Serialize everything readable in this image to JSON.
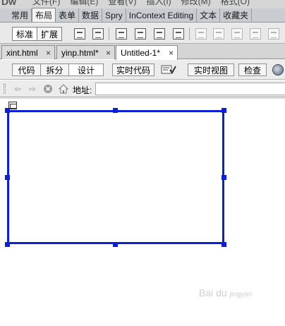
{
  "menubar": {
    "logo": "Dw",
    "items": [
      "文件(F)",
      "编辑(E)",
      "查看(V)",
      "插入(I)",
      "修改(M)",
      "格式(O)"
    ]
  },
  "insert_tabs": [
    "常用",
    "布局",
    "表单",
    "数据",
    "Spry",
    "InContext Editing",
    "文本",
    "收藏夹"
  ],
  "insert_tabs_active": "布局",
  "layout_toolbar": {
    "modes": [
      "标准",
      "扩展"
    ],
    "active_mode": "标准"
  },
  "document_tabs": [
    {
      "name": "xint.html",
      "close": "×"
    },
    {
      "name": "yinp.html*",
      "close": "×"
    },
    {
      "name": "Untitled-1*",
      "close": "×"
    }
  ],
  "document_tabs_active": "Untitled-1*",
  "view_toolbar": {
    "view_modes": [
      "代码",
      "拆分",
      "设计"
    ],
    "active_view": "设计",
    "live_code": "实时代码",
    "live_view": "实时视图",
    "inspect": "检查"
  },
  "address_bar": {
    "label": "地址:",
    "value": ""
  },
  "watermark": {
    "brand": "Bai du",
    "sub": "jingyan"
  },
  "colors": {
    "selection": "#0a1fd6",
    "toolbar_bg": "#e9e9e9"
  }
}
